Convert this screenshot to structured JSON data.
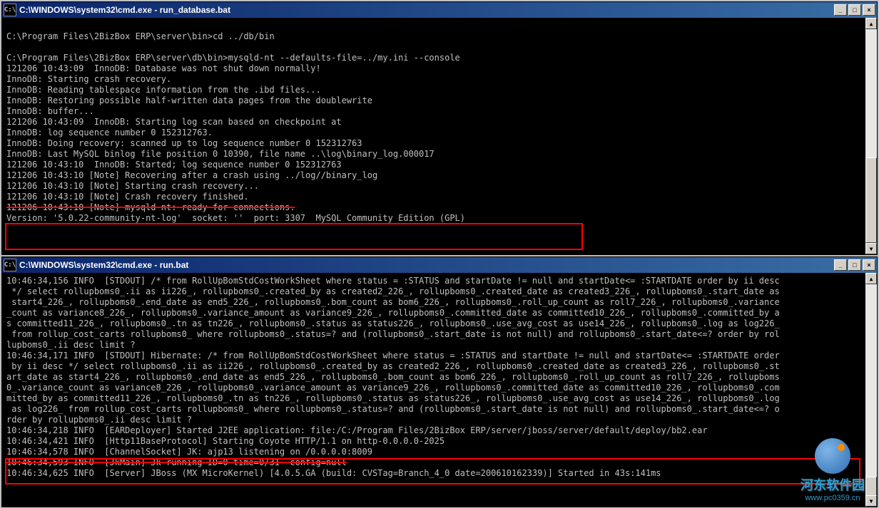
{
  "window1": {
    "icon_label": "C:\\",
    "title": "C:\\WINDOWS\\system32\\cmd.exe - run_database.bat",
    "btn_min": "_",
    "btn_max": "□",
    "btn_close": "×",
    "scroll_up": "▲",
    "scroll_down": "▼",
    "lines": [
      "",
      "C:\\Program Files\\2BizBox ERP\\server\\bin>cd ../db/bin",
      "",
      "C:\\Program Files\\2BizBox ERP\\server\\db\\bin>mysqld-nt --defaults-file=../my.ini --console",
      "121206 10:43:09  InnoDB: Database was not shut down normally!",
      "InnoDB: Starting crash recovery.",
      "InnoDB: Reading tablespace information from the .ibd files...",
      "InnoDB: Restoring possible half-written data pages from the doublewrite",
      "InnoDB: buffer...",
      "121206 10:43:09  InnoDB: Starting log scan based on checkpoint at",
      "InnoDB: log sequence number 0 152312763.",
      "InnoDB: Doing recovery: scanned up to log sequence number 0 152312763",
      "InnoDB: Last MySQL binlog file position 0 10390, file name ..\\log\\binary_log.000017",
      "121206 10:43:10  InnoDB: Started; log sequence number 0 152312763",
      "121206 10:43:10 [Note] Recovering after a crash using ../log//binary_log",
      "121206 10:43:10 [Note] Starting crash recovery...",
      "121206 10:43:10 [Note] Crash recovery finished.",
      "121206 10:43:10 [Note] mysqld-nt: ready for connections.",
      "Version: '5.0.22-community-nt-log'  socket: ''  port: 3307  MySQL Community Edition (GPL)"
    ]
  },
  "window2": {
    "icon_label": "C:\\",
    "title": "C:\\WINDOWS\\system32\\cmd.exe - run.bat",
    "btn_min": "_",
    "btn_max": "□",
    "btn_close": "×",
    "scroll_up": "▲",
    "scroll_down": "▼",
    "lines": [
      "10:46:34,156 INFO  [STDOUT] /* from RollUpBomStdCostWorkSheet where status = :STATUS and startDate != null and startDate<= :STARTDATE order by ii desc",
      " */ select rollupboms0_.ii as ii226_, rollupboms0_.created_by as created2_226_, rollupboms0_.created_date as created3_226_, rollupboms0_.start_date as",
      " start4_226_, rollupboms0_.end_date as end5_226_, rollupboms0_.bom_count as bom6_226_, rollupboms0_.roll_up_count as roll7_226_, rollupboms0_.variance",
      "_count as variance8_226_, rollupboms0_.variance_amount as variance9_226_, rollupboms0_.committed_date as committed10_226_, rollupboms0_.committed_by a",
      "s committed11_226_, rollupboms0_.tn as tn226_, rollupboms0_.status as status226_, rollupboms0_.use_avg_cost as use14_226_, rollupboms0_.log as log226_",
      " from rollup_cost_carts rollupboms0_ where rollupboms0_.status=? and (rollupboms0_.start_date is not null) and rollupboms0_.start_date<=? order by rol",
      "lupboms0_.ii desc limit ?",
      "10:46:34,171 INFO  [STDOUT] Hibernate: /* from RollUpBomStdCostWorkSheet where status = :STATUS and startDate != null and startDate<= :STARTDATE order",
      " by ii desc */ select rollupboms0_.ii as ii226_, rollupboms0_.created_by as created2_226_, rollupboms0_.created_date as created3_226_, rollupboms0_.st",
      "art_date as start4_226_, rollupboms0_.end_date as end5_226_, rollupboms0_.bom_count as bom6_226_, rollupboms0_.roll_up_count as roll7_226_, rollupboms",
      "0_.variance_count as variance8_226_, rollupboms0_.variance_amount as variance9_226_, rollupboms0_.committed_date as committed10_226_, rollupboms0_.com",
      "mitted_by as committed11_226_, rollupboms0_.tn as tn226_, rollupboms0_.status as status226_, rollupboms0_.use_avg_cost as use14_226_, rollupboms0_.log",
      " as log226_ from rollup_cost_carts rollupboms0_ where rollupboms0_.status=? and (rollupboms0_.start_date is not null) and rollupboms0_.start_date<=? o",
      "rder by rollupboms0_.ii desc limit ?",
      "10:46:34,218 INFO  [EARDeployer] Started J2EE application: file:/C:/Program Files/2BizBox ERP/server/jboss/server/default/deploy/bb2.ear",
      "10:46:34,421 INFO  [Http11BaseProtocol] Starting Coyote HTTP/1.1 on http-0.0.0.0-2025",
      "10:46:34,578 INFO  [ChannelSocket] JK: ajp13 listening on /0.0.0.0:8009",
      "10:46:34,593 INFO  [JkMain] Jk running ID=0 time=0/31  config=null",
      "10:46:34,625 INFO  [Server] JBoss (MX MicroKernel) [4.0.5.GA (build: CVSTag=Branch_4_0 date=200610162339)] Started in 43s:141ms"
    ]
  },
  "watermark": {
    "text": "河东软件园",
    "url": "www.pc0359.cn"
  }
}
